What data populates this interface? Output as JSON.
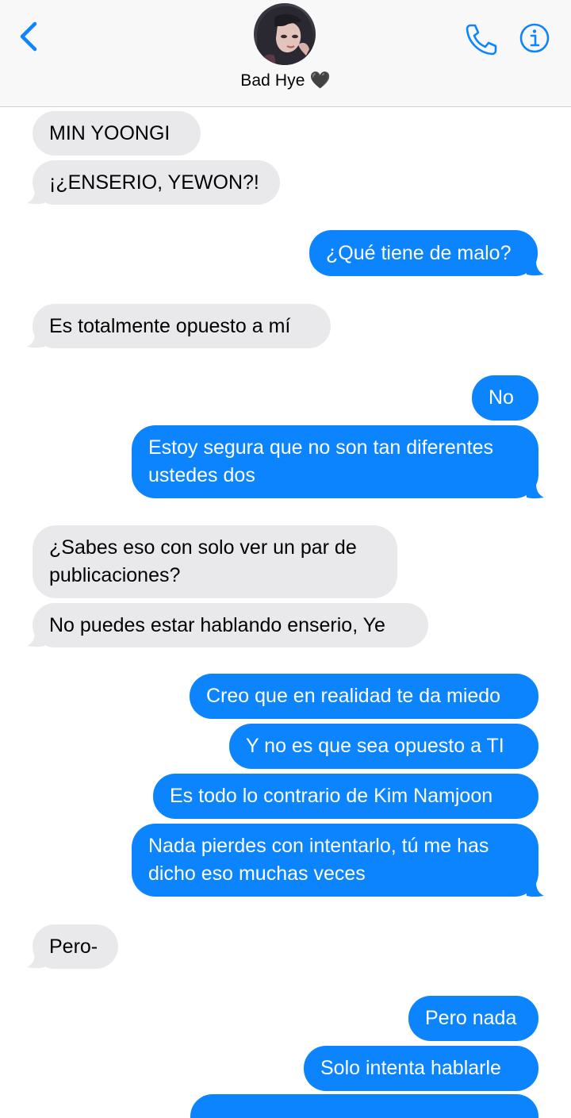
{
  "header": {
    "contact_name": "Bad Hye 🖤",
    "back_icon": "chevron-left-icon",
    "phone_icon": "phone-icon",
    "info_icon": "info-icon",
    "accent_color": "#0b84fe"
  },
  "messages": [
    {
      "direction": "incoming",
      "text": "MIN YOONGI"
    },
    {
      "direction": "incoming",
      "text": "¡¿ENSERIO, YEWON?!"
    },
    {
      "direction": "outgoing",
      "text": "¿Qué tiene de malo?"
    },
    {
      "direction": "incoming",
      "text": "Es totalmente opuesto a mí"
    },
    {
      "direction": "outgoing",
      "text": "No"
    },
    {
      "direction": "outgoing",
      "text": "Estoy segura que no son tan diferentes ustedes dos"
    },
    {
      "direction": "incoming",
      "text": "¿Sabes eso con solo ver un par de publicaciones?"
    },
    {
      "direction": "incoming",
      "text": "No puedes estar hablando enserio, Ye"
    },
    {
      "direction": "outgoing",
      "text": "Creo que en realidad te da miedo"
    },
    {
      "direction": "outgoing",
      "text": "Y no es que sea opuesto a TI"
    },
    {
      "direction": "outgoing",
      "text": "Es todo lo contrario de Kim Namjoon"
    },
    {
      "direction": "outgoing",
      "text": "Nada pierdes con intentarlo, tú me has dicho eso muchas veces"
    },
    {
      "direction": "incoming",
      "text": "Pero-"
    },
    {
      "direction": "outgoing",
      "text": "Pero nada"
    },
    {
      "direction": "outgoing",
      "text": "Solo intenta hablarle"
    }
  ],
  "colors": {
    "incoming_bubble": "#e9e9eb",
    "outgoing_bubble": "#0b84fe",
    "header_bg": "#f8f8f9"
  }
}
